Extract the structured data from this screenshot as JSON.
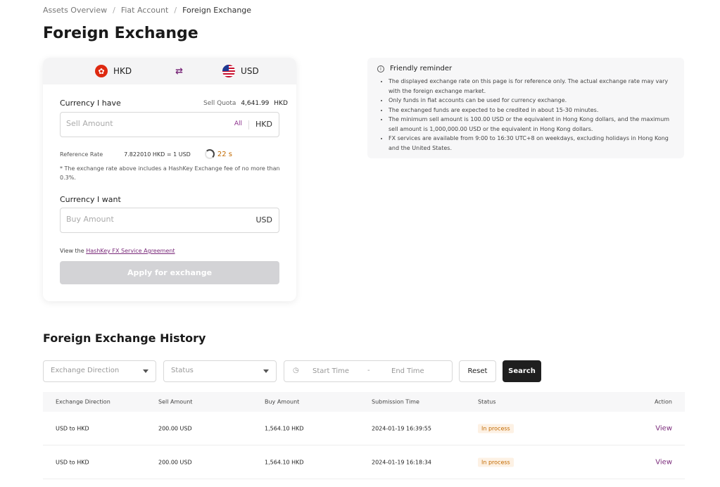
{
  "breadcrumb": [
    "Assets Overview",
    "Fiat Account",
    "Foreign Exchange"
  ],
  "page_title": "Foreign Exchange",
  "exchange": {
    "from_currency": "HKD",
    "to_currency": "USD",
    "have_label": "Currency I have",
    "sell_quota_label": "Sell Quota",
    "sell_quota_value": "4,641.99",
    "sell_quota_unit": "HKD",
    "sell_placeholder": "Sell Amount",
    "all_label": "All",
    "sell_unit": "HKD",
    "ref_rate_label": "Reference Rate",
    "ref_rate_value": "7.822010  HKD = 1 USD",
    "countdown": "22 s",
    "fee_note": "* The exchange rate above includes a HashKey Exchange fee of no more than 0.3%.",
    "want_label": "Currency I want",
    "buy_placeholder": "Buy Amount",
    "buy_unit": "USD",
    "agreement_prefix": "View the",
    "agreement_link": "HashKey FX Service Agreement",
    "apply_label": "Apply for exchange"
  },
  "reminder": {
    "title": "Friendly reminder",
    "items": [
      "The displayed exchange rate on this page is for reference only. The actual exchange rate may vary with the foreign exchange market.",
      "Only funds in fiat accounts can be used for currency exchange.",
      "The exchanged funds are expected to be credited in about 15-30 minutes.",
      "The minimum sell amount is 100.00 USD or the equivalent in Hong Kong dollars, and the maximum sell amount is 1,000,000.00 USD or the equivalent in Hong Kong dollars.",
      "FX services are available from 9:00 to 16:30 UTC+8 on weekdays, excluding holidays in Hong Kong and the United States."
    ]
  },
  "history": {
    "title": "Foreign Exchange History",
    "direction_placeholder": "Exchange Direction",
    "status_placeholder": "Status",
    "start_time": "Start Time",
    "range_sep": "-",
    "end_time": "End Time",
    "reset_label": "Reset",
    "search_label": "Search",
    "columns": [
      "Exchange Direction",
      "Sell Amount",
      "Buy Amount",
      "Submission Time",
      "Status",
      "Action"
    ],
    "rows": [
      {
        "direction": "USD to HKD",
        "sell": "200.00 USD",
        "buy": "1,564.10 HKD",
        "time": "2024-01-19 16:39:55",
        "status": "In process",
        "action": "View"
      },
      {
        "direction": "USD to HKD",
        "sell": "200.00 USD",
        "buy": "1,564.10 HKD",
        "time": "2024-01-19 16:18:34",
        "status": "In process",
        "action": "View"
      }
    ]
  }
}
